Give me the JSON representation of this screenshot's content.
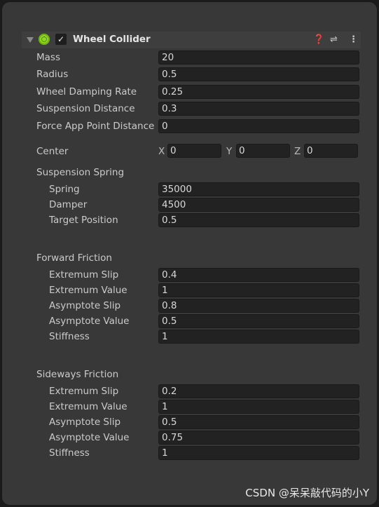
{
  "component": {
    "title": "Wheel Collider",
    "enabled": true,
    "icons": [
      "help-icon",
      "preset-icon",
      "more-icon"
    ]
  },
  "fields": [
    {
      "label": "Mass",
      "value": "20"
    },
    {
      "label": "Radius",
      "value": "0.5"
    },
    {
      "label": "Wheel Damping Rate",
      "value": "0.25"
    },
    {
      "label": "Suspension Distance",
      "value": "0.3"
    },
    {
      "label": "Force App Point Distance",
      "value": "0"
    }
  ],
  "center": {
    "label": "Center",
    "x_label": "X",
    "x": "0",
    "y_label": "Y",
    "y": "0",
    "z_label": "Z",
    "z": "0"
  },
  "suspension_spring": {
    "label": "Suspension Spring",
    "fields": [
      {
        "label": "Spring",
        "value": "35000"
      },
      {
        "label": "Damper",
        "value": "4500"
      },
      {
        "label": "Target Position",
        "value": "0.5"
      }
    ]
  },
  "forward_friction": {
    "label": "Forward Friction",
    "fields": [
      {
        "label": "Extremum Slip",
        "value": "0.4"
      },
      {
        "label": "Extremum Value",
        "value": "1"
      },
      {
        "label": "Asymptote Slip",
        "value": "0.8"
      },
      {
        "label": "Asymptote Value",
        "value": "0.5"
      },
      {
        "label": "Stiffness",
        "value": "1"
      }
    ]
  },
  "sideways_friction": {
    "label": "Sideways Friction",
    "fields": [
      {
        "label": "Extremum Slip",
        "value": "0.2"
      },
      {
        "label": "Extremum Value",
        "value": "1"
      },
      {
        "label": "Asymptote Slip",
        "value": "0.5"
      },
      {
        "label": "Asymptote Value",
        "value": "0.75"
      },
      {
        "label": "Stiffness",
        "value": "1"
      }
    ]
  },
  "watermark": "CSDN @呆呆敲代码的小Y"
}
